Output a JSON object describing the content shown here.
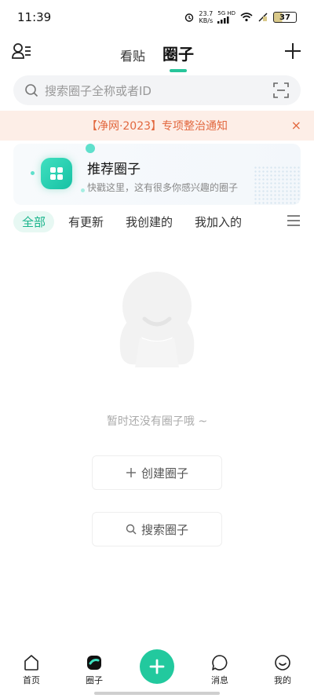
{
  "status_bar": {
    "time": "11:39",
    "speed_value": "23.7",
    "speed_unit": "KB/s",
    "net_top": "5G HD",
    "net_bottom": "",
    "battery": "37"
  },
  "header": {
    "tab_posts": "看贴",
    "tab_circles": "圈子"
  },
  "search": {
    "placeholder": "搜索圈子全称或者ID"
  },
  "notice": {
    "text": "【净网·2023】专项整治通知",
    "close": "×"
  },
  "recommend": {
    "title": "推荐圈子",
    "subtitle": "快戳这里，这有很多你感兴趣的圈子"
  },
  "filters": [
    {
      "label": "全部"
    },
    {
      "label": "有更新"
    },
    {
      "label": "我创建的"
    },
    {
      "label": "我加入的"
    }
  ],
  "empty": {
    "message": "暂时还没有圈子哦 ~",
    "create_label": "创建圈子",
    "search_label": "搜索圈子"
  },
  "bottom_nav": {
    "home": "首页",
    "circle": "圈子",
    "messages": "消息",
    "mine": "我的"
  },
  "colors": {
    "accent": "#28c59b",
    "notice_text": "#e2683f",
    "notice_bg": "#fdeee7"
  }
}
